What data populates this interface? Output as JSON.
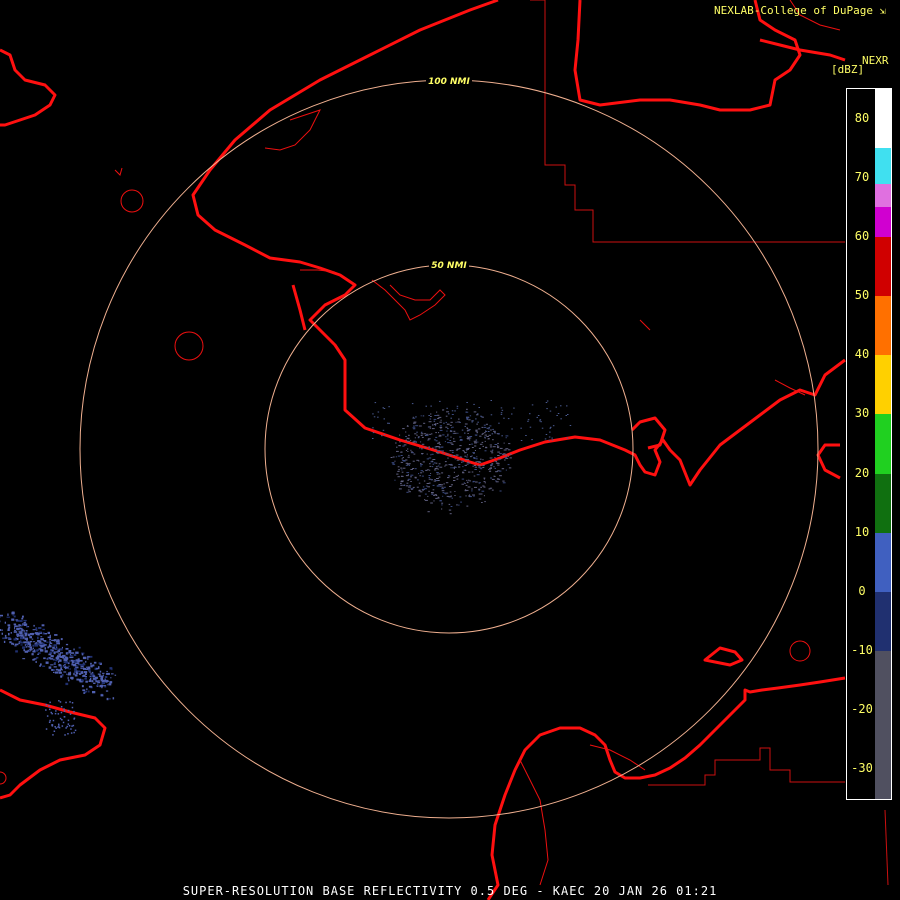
{
  "header": {
    "credit": "NEXLAB-College of DuPage",
    "product": "NEXR",
    "units": "[dBZ]"
  },
  "footer": {
    "caption": "SUPER-RESOLUTION BASE REFLECTIVITY 0.5 DEG - KAEC 20 JAN 26 01:21"
  },
  "range_rings": {
    "inner_label": "50 NMI",
    "outer_label": "100 NMI",
    "color": "#f0b090"
  },
  "colors": {
    "coastline": "#ff1010",
    "border": "#cc1010",
    "echo_light": "#5060b0",
    "echo_clear_air": "#606080",
    "label": "#ffff66"
  },
  "colorbar": {
    "ticks": [
      "80",
      "70",
      "60",
      "50",
      "40",
      "30",
      "20",
      "10",
      "0",
      "-10",
      "-20",
      "-30"
    ],
    "min_dbz": -35,
    "max_dbz": 85,
    "bands": [
      {
        "from": 75,
        "to": 85,
        "color": "#ffffff"
      },
      {
        "from": 69,
        "to": 75,
        "color": "#40e0f0"
      },
      {
        "from": 65,
        "to": 69,
        "color": "#e070e0"
      },
      {
        "from": 60,
        "to": 65,
        "color": "#d000d0"
      },
      {
        "from": 50,
        "to": 60,
        "color": "#d00000"
      },
      {
        "from": 40,
        "to": 50,
        "color": "#ff7000"
      },
      {
        "from": 30,
        "to": 40,
        "color": "#ffd000"
      },
      {
        "from": 20,
        "to": 30,
        "color": "#20d020"
      },
      {
        "from": 10,
        "to": 20,
        "color": "#107010"
      },
      {
        "from": 0,
        "to": 10,
        "color": "#4060c0"
      },
      {
        "from": -10,
        "to": 0,
        "color": "#203070"
      },
      {
        "from": -35,
        "to": -10,
        "color": "#505060"
      }
    ]
  }
}
